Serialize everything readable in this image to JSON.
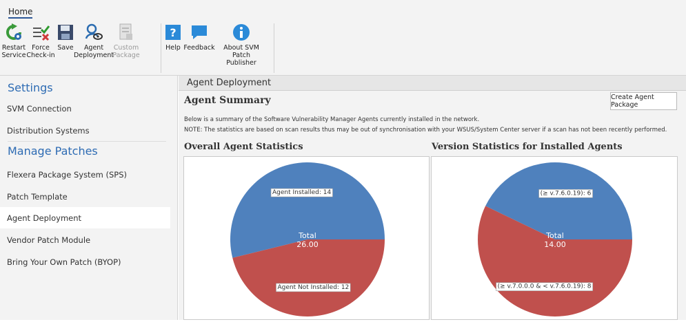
{
  "ribbon": {
    "tab": "Home",
    "buttons": [
      {
        "label": "Restart Service",
        "icon": "restart-icon",
        "enabled": true
      },
      {
        "label": "Force Check-in",
        "icon": "force-checkin-icon",
        "enabled": true
      },
      {
        "label": "Save",
        "icon": "save-icon",
        "enabled": true
      },
      {
        "label": "Agent Deployment",
        "icon": "agent-deployment-icon",
        "enabled": true
      },
      {
        "label": "Custom Package",
        "icon": "custom-package-icon",
        "enabled": false
      },
      {
        "label": "Help",
        "icon": "help-icon",
        "enabled": true
      },
      {
        "label": "Feedback",
        "icon": "feedback-icon",
        "enabled": true
      },
      {
        "label": "About SVM Patch Publisher",
        "icon": "info-icon",
        "enabled": true
      }
    ]
  },
  "sidebar": {
    "sections": [
      {
        "title": "Settings",
        "items": [
          "SVM Connection",
          "Distribution Systems"
        ]
      },
      {
        "title": "Manage Patches",
        "items": [
          "Flexera Package System (SPS)",
          "Patch Template",
          "Agent Deployment",
          "Vendor Patch Module",
          "Bring Your Own Patch (BYOP)"
        ]
      }
    ],
    "active_item": "Agent Deployment"
  },
  "main": {
    "header": "Agent Deployment",
    "summary_title": "Agent Summary",
    "create_button": "Create Agent Package",
    "desc_line1": "Below is a summary of the Software Vulnerability Manager Agents currently installed in the network.",
    "desc_line2": "NOTE: The statistics are based on scan results thus may be out of synchronisation with your WSUS/System Center server if a scan has not been recently performed.",
    "overall_title": "Overall Agent Statistics",
    "version_title": "Version Statistics for Installed Agents"
  },
  "colors": {
    "blue_slice": "#4f81bd",
    "red_slice": "#c0504d",
    "accent": "#2d6bb3"
  },
  "chart_data": [
    {
      "type": "pie",
      "categories": [
        "Agent Installed",
        "Agent Not Installed"
      ],
      "values": [
        14,
        12
      ],
      "slice_labels": [
        "Agent Installed: 14",
        "Agent Not Installed: 12"
      ],
      "center_label": "Total",
      "center_value": "26.00"
    },
    {
      "type": "pie",
      "categories": [
        "(≥ v.7.6.0.19)",
        "(≥ v.7.0.0.0 & < v.7.6.0.19)"
      ],
      "values": [
        6,
        8
      ],
      "slice_labels": [
        "(≥ v.7.6.0.19): 6",
        "(≥ v.7.0.0.0 & < v.7.6.0.19): 8"
      ],
      "center_label": "Total",
      "center_value": "14.00"
    }
  ]
}
